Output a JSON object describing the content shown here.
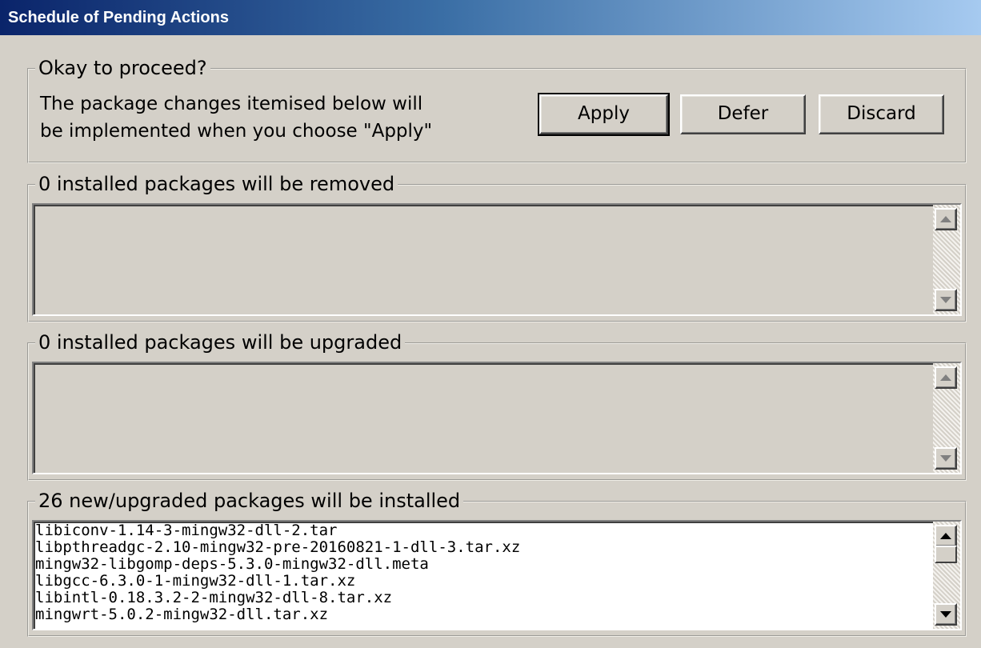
{
  "window": {
    "title": "Schedule of Pending Actions"
  },
  "proceed": {
    "legend": "Okay to proceed?",
    "line1": "The package changes itemised below will",
    "line2": "be implemented when you choose \"Apply\"",
    "apply_label": "Apply",
    "defer_label": "Defer",
    "discard_label": "Discard"
  },
  "remove": {
    "legend": "0 installed packages will be removed"
  },
  "upgrade": {
    "legend": "0 installed packages will be upgraded"
  },
  "install": {
    "legend": "26 new/upgraded packages will be installed",
    "items": [
      "libiconv-1.14-3-mingw32-dll-2.tar",
      "libpthreadgc-2.10-mingw32-pre-20160821-1-dll-3.tar.xz",
      "mingw32-libgomp-deps-5.3.0-mingw32-dll.meta",
      "libgcc-6.3.0-1-mingw32-dll-1.tar.xz",
      "libintl-0.18.3.2-2-mingw32-dll-8.tar.xz",
      "mingwrt-5.0.2-mingw32-dll.tar.xz"
    ]
  },
  "icons": {
    "scroll_up": "scroll-up-arrow-icon",
    "scroll_down": "scroll-down-arrow-icon"
  }
}
